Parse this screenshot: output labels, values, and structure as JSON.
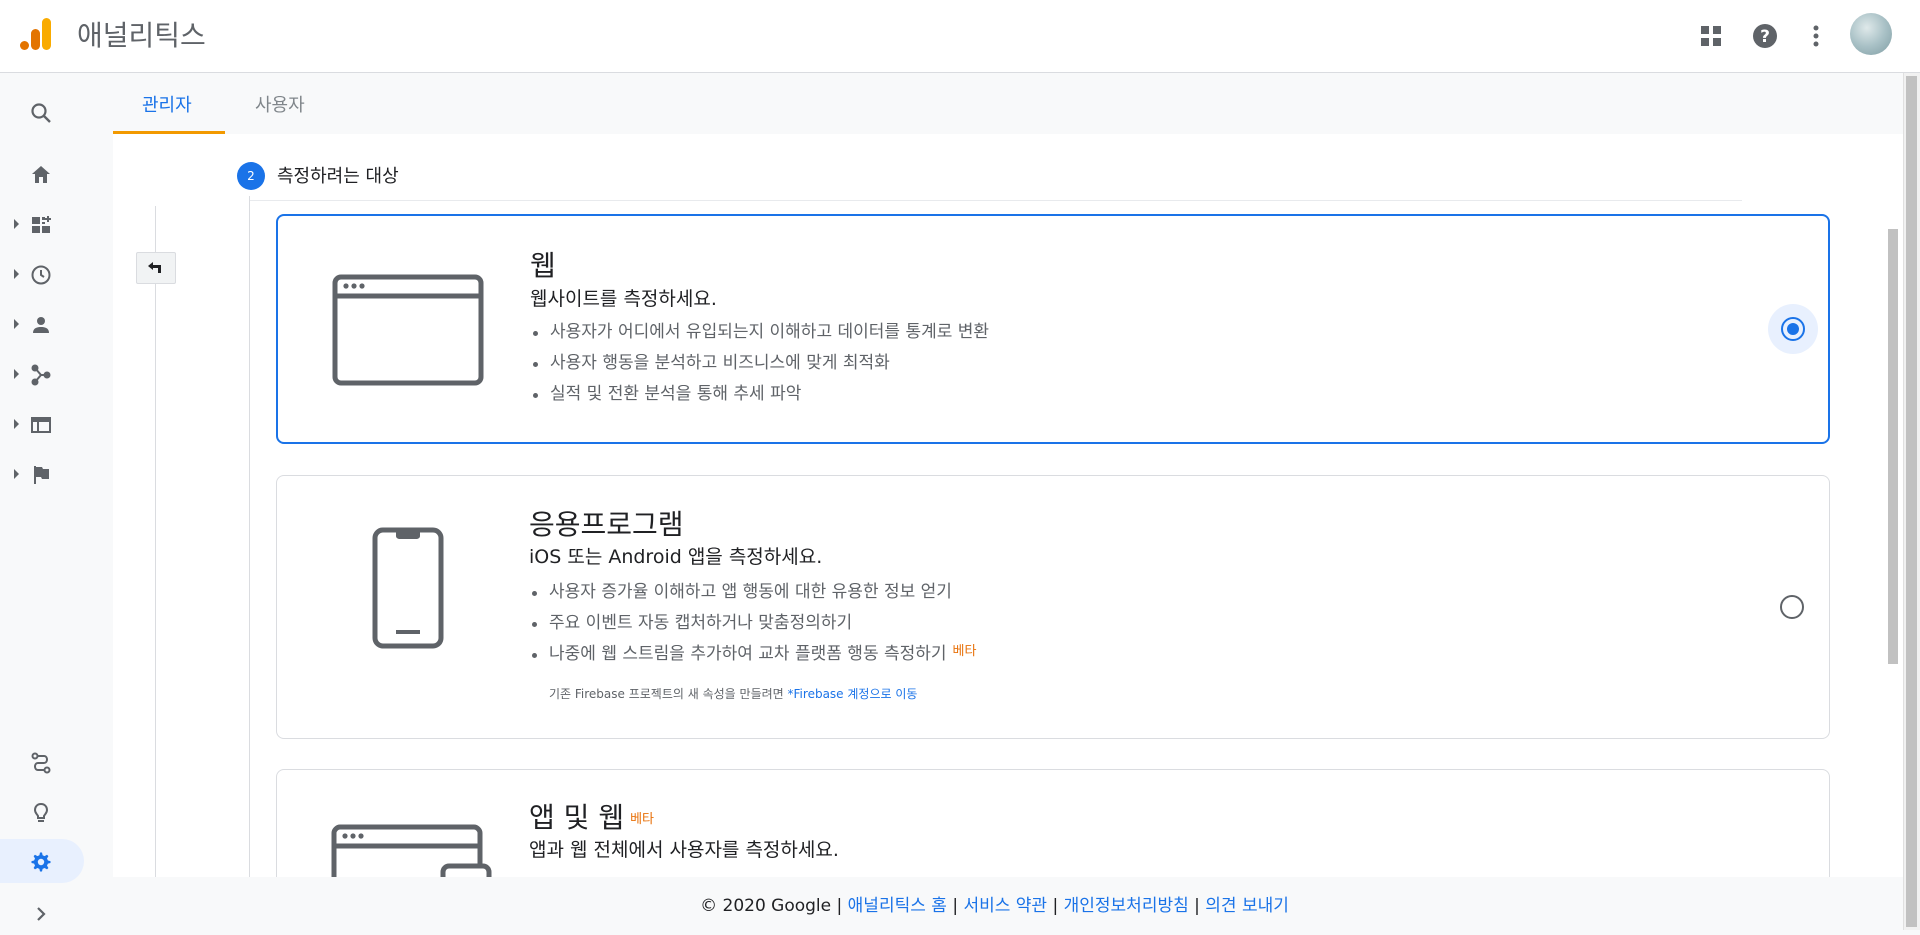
{
  "header": {
    "app_title": "애널리틱스",
    "icons": [
      "apps-grid-icon",
      "help-icon",
      "more-vert-icon",
      "avatar"
    ]
  },
  "sidebar": {
    "items": [
      {
        "icon": "search-icon",
        "expandable": false
      },
      {
        "icon": "home-icon",
        "expandable": false
      },
      {
        "icon": "dashboard-icon",
        "expandable": true
      },
      {
        "icon": "realtime-clock-icon",
        "expandable": true
      },
      {
        "icon": "audience-person-icon",
        "expandable": true
      },
      {
        "icon": "acquisition-icon",
        "expandable": true
      },
      {
        "icon": "behavior-icon",
        "expandable": true
      },
      {
        "icon": "conversions-flag-icon",
        "expandable": true
      }
    ],
    "bottom_items": [
      {
        "icon": "attribution-icon"
      },
      {
        "icon": "discover-lightbulb-icon"
      },
      {
        "icon": "admin-gear-icon",
        "active": true
      },
      {
        "icon": "expand-chevron-icon"
      }
    ]
  },
  "tabs": {
    "admin": "관리자",
    "user": "사용자",
    "active": "admin"
  },
  "step": {
    "number": "2",
    "title": "측정하려는 대상"
  },
  "options": [
    {
      "title": "웹",
      "subtitle": "웹사이트를 측정하세요.",
      "bullets": [
        "사용자가 어디에서 유입되는지 이해하고 데이터를 통계로 변환",
        "사용자 행동을 분석하고 비즈니스에 맞게 최적화",
        "실적 및 전환 분석을 통해 추세 파악"
      ],
      "selected": true
    },
    {
      "title": "응용프로그램",
      "subtitle": "iOS 또는 Android 앱을 측정하세요.",
      "bullets": [
        "사용자 증가율 이해하고 앱 행동에 대한 유용한 정보 얻기",
        "주요 이벤트 자동 캡처하거나 맞춤정의하기",
        "나중에 웹 스트림을 추가하여 교차 플랫폼 행동 측정하기"
      ],
      "beta_label": "베타",
      "note": "기존 Firebase 프로젝트의 새 속성을 만들려면",
      "note_link": "*Firebase 계정으로 이동",
      "selected": false
    },
    {
      "title": "앱 및 웹",
      "beta_label": "베타",
      "subtitle": "앱과 웹 전체에서 사용자를 측정하세요.",
      "selected": false
    }
  ],
  "footer": {
    "copyright": "© 2020 Google",
    "sep": "|",
    "links": [
      "애널리틱스 홈",
      "서비스 약관",
      "개인정보처리방침",
      "의견 보내기"
    ]
  },
  "colors": {
    "accent": "#1a73e8",
    "tab_underline": "#f29900",
    "beta": "#e8710a",
    "logo_orange": "#f9ab00",
    "logo_dark": "#e37400"
  }
}
